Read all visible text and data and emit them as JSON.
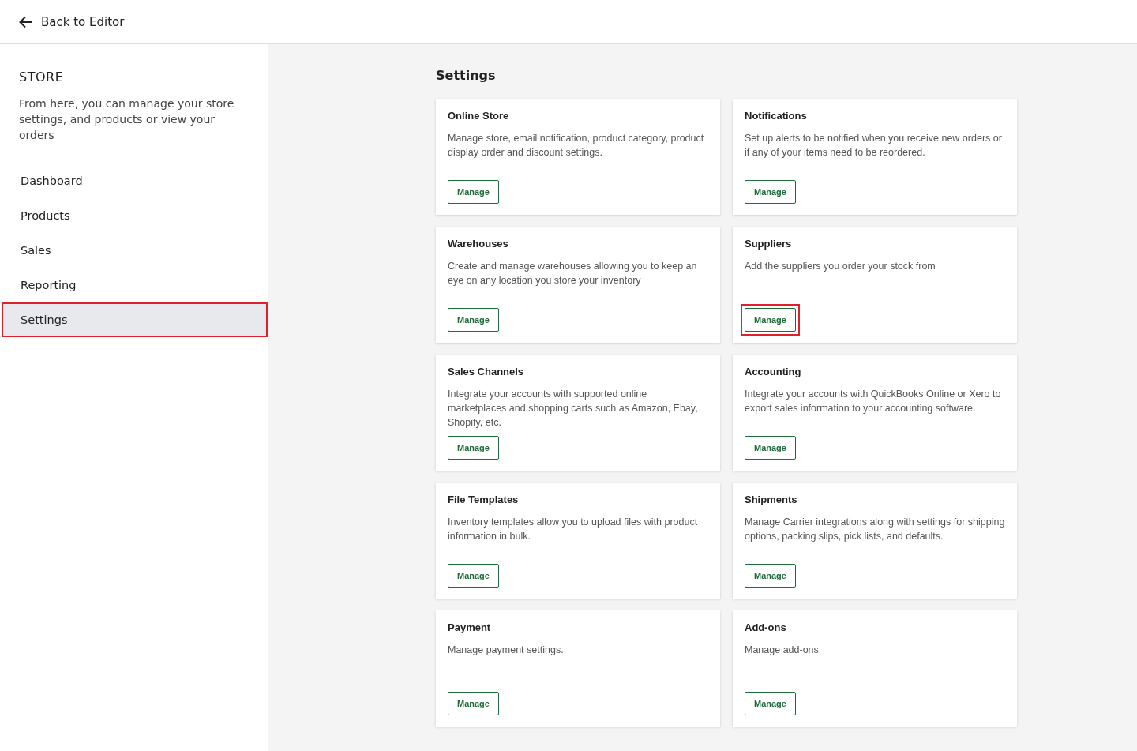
{
  "topbar": {
    "back_label": "Back to Editor"
  },
  "sidebar": {
    "title": "STORE",
    "description": "From here, you can manage your store settings, and products or view your orders",
    "items": [
      {
        "label": "Dashboard",
        "selected": false,
        "highlighted": false
      },
      {
        "label": "Products",
        "selected": false,
        "highlighted": false
      },
      {
        "label": "Sales",
        "selected": false,
        "highlighted": false
      },
      {
        "label": "Reporting",
        "selected": false,
        "highlighted": false
      },
      {
        "label": "Settings",
        "selected": true,
        "highlighted": true
      }
    ]
  },
  "main": {
    "title": "Settings",
    "cards": [
      {
        "title": "Online Store",
        "description": "Manage store, email notification, product category, product display order and discount settings.",
        "button": "Manage",
        "highlighted": false
      },
      {
        "title": "Notifications",
        "description": "Set up alerts to be notified when you receive new orders or if any of your items need to be reordered.",
        "button": "Manage",
        "highlighted": false
      },
      {
        "title": "Warehouses",
        "description": "Create and manage warehouses allowing you to keep an eye on any location you store your inventory",
        "button": "Manage",
        "highlighted": false
      },
      {
        "title": "Suppliers",
        "description": "Add the suppliers you order your stock from",
        "button": "Manage",
        "highlighted": true
      },
      {
        "title": "Sales Channels",
        "description": "Integrate your accounts with supported online marketplaces and shopping carts such as Amazon, Ebay, Shopify, etc.",
        "button": "Manage",
        "highlighted": false
      },
      {
        "title": "Accounting",
        "description": "Integrate your accounts with QuickBooks Online or Xero to export sales information to your accounting software.",
        "button": "Manage",
        "highlighted": false
      },
      {
        "title": "File Templates",
        "description": "Inventory templates allow you to upload files with product information in bulk.",
        "button": "Manage",
        "highlighted": false
      },
      {
        "title": "Shipments",
        "description": "Manage Carrier integrations along with settings for shipping options, packing slips, pick lists, and defaults.",
        "button": "Manage",
        "highlighted": false
      },
      {
        "title": "Payment",
        "description": "Manage payment settings.",
        "button": "Manage",
        "highlighted": false
      },
      {
        "title": "Add-ons",
        "description": "Manage add-ons",
        "button": "Manage",
        "highlighted": false
      }
    ]
  }
}
